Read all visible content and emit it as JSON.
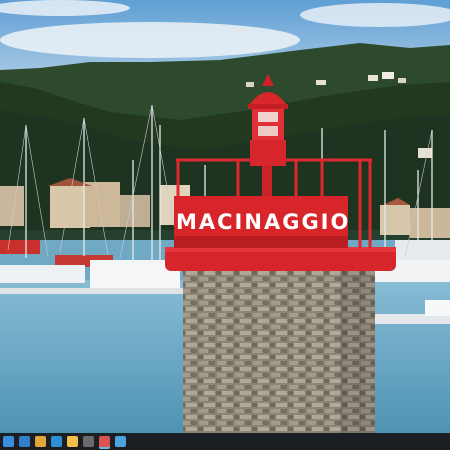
{
  "sign": {
    "text": "MACINAGGIO"
  },
  "taskbar": {
    "icons": [
      {
        "name": "windows-icon",
        "color": "#3b8ede"
      },
      {
        "name": "mail-icon",
        "color": "#2f7fc9"
      },
      {
        "name": "chrome-icon",
        "color": "#e1a63a"
      },
      {
        "name": "photos-icon",
        "color": "#2f8fd6"
      },
      {
        "name": "file-explorer-icon",
        "color": "#f2c04a"
      },
      {
        "name": "app-icon",
        "color": "#6b6b6b"
      },
      {
        "name": "browser-icon",
        "color": "#d9534f"
      },
      {
        "name": "photo-app-icon",
        "color": "#4ca3e0"
      }
    ]
  }
}
